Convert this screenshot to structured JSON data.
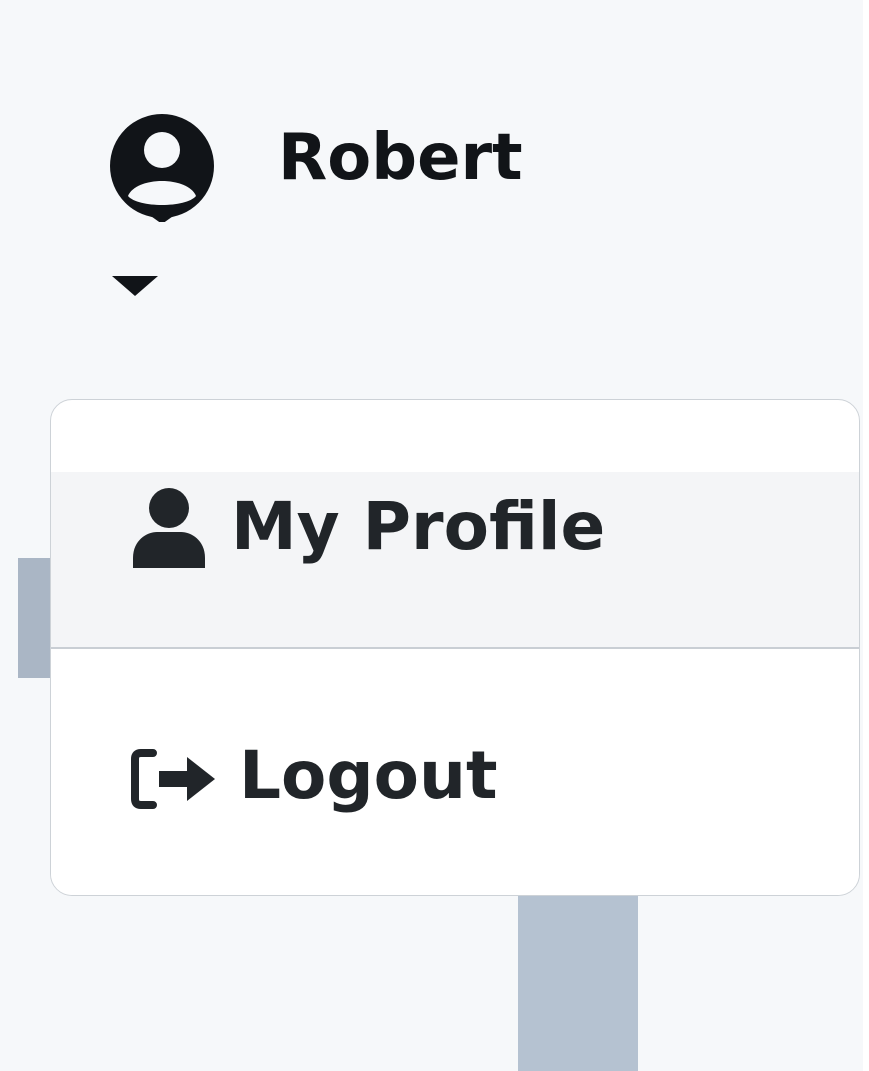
{
  "user_menu": {
    "user_name": "Robert",
    "avatar_icon": "user-circle-icon",
    "caret_icon": "caret-down-icon"
  },
  "dropdown": {
    "items": [
      {
        "label": "My Profile",
        "icon": "user-icon"
      },
      {
        "label": "Logout",
        "icon": "sign-out-icon"
      }
    ]
  },
  "colors": {
    "panel_background": "#f6f8fa",
    "text": "#212529",
    "menu_border": "#cdd2d7",
    "hover_row": "#f4f5f7"
  }
}
